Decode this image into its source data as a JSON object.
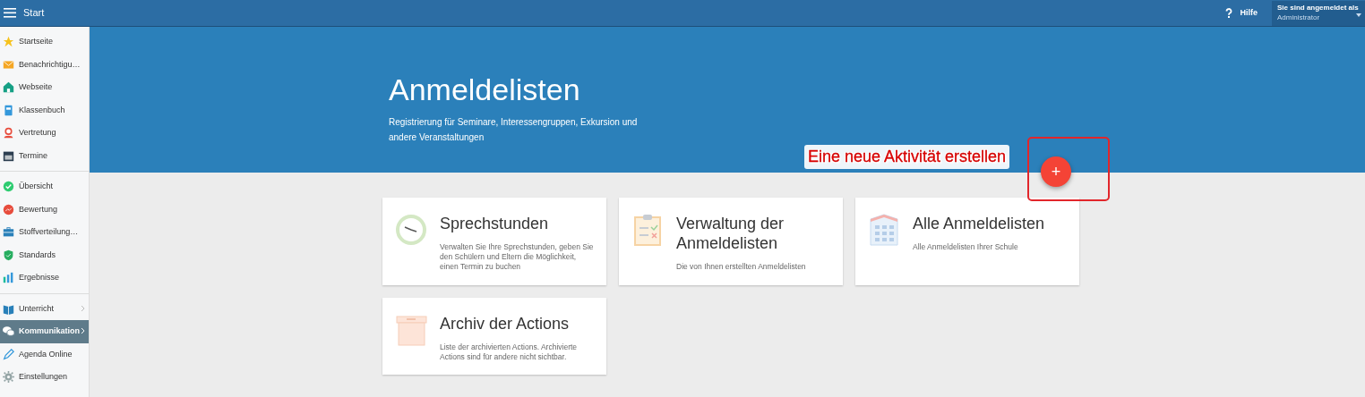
{
  "topbar": {
    "title": "Start",
    "help": "Hilfe",
    "user_label": "Sie sind angemeldet als",
    "user_name": "Administrator"
  },
  "sidebar": {
    "groups": [
      [
        {
          "label": "Startseite",
          "selected": false,
          "expandable": false
        },
        {
          "label": "Benachrichtigu…",
          "selected": false,
          "expandable": false
        },
        {
          "label": "Webseite",
          "selected": false,
          "expandable": false
        },
        {
          "label": "Klassenbuch",
          "selected": false,
          "expandable": false
        },
        {
          "label": "Vertretung",
          "selected": false,
          "expandable": false
        },
        {
          "label": "Termine",
          "selected": false,
          "expandable": false
        }
      ],
      [
        {
          "label": "Übersicht",
          "selected": false,
          "expandable": false
        },
        {
          "label": "Bewertung",
          "selected": false,
          "expandable": false
        },
        {
          "label": "Stoffverteilung…",
          "selected": false,
          "expandable": false
        },
        {
          "label": "Standards",
          "selected": false,
          "expandable": false
        },
        {
          "label": "Ergebnisse",
          "selected": false,
          "expandable": false
        }
      ],
      [
        {
          "label": "Unterricht",
          "selected": false,
          "expandable": true
        },
        {
          "label": "Kommunikation",
          "selected": true,
          "expandable": true
        },
        {
          "label": "Agenda Online",
          "selected": false,
          "expandable": false
        },
        {
          "label": "Einstellungen",
          "selected": false,
          "expandable": false
        }
      ]
    ]
  },
  "hero": {
    "title": "Anmeldelisten",
    "subtitle": "Registrierung für Seminare, Interessengruppen, Exkursion und andere Veranstaltungen"
  },
  "annotation": {
    "text": "Eine neue Aktivität erstellen"
  },
  "add_button": {
    "label": "+"
  },
  "cards": [
    {
      "title": "Sprechstunden",
      "description": "Verwalten Sie Ihre Sprechstunden, geben Sie den Schülern und Eltern die Möglichkeit, einen Termin zu buchen"
    },
    {
      "title": "Verwaltung der Anmeldelisten",
      "description": "Die von Ihnen erstellten Anmeldelisten"
    },
    {
      "title": "Alle Anmeldelisten",
      "description": "Alle Anmeldelisten Ihrer Schule"
    },
    {
      "title": "Archiv der Actions",
      "description": "Liste der archivierten Actions. Archivierte Actions sind für andere nicht sichtbar."
    }
  ]
}
